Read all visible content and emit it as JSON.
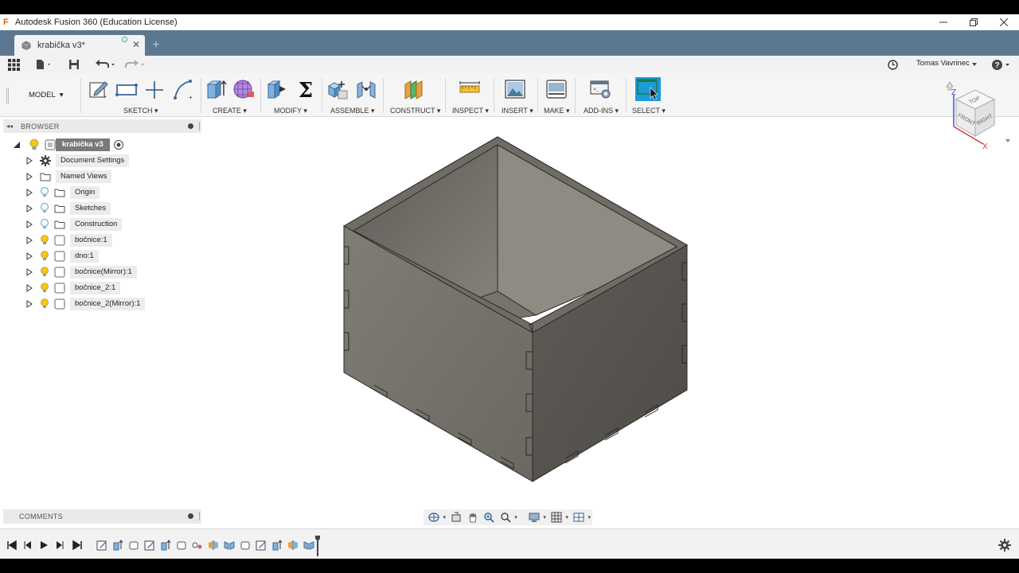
{
  "window": {
    "title": "Autodesk Fusion 360 (Education License)",
    "app_logo": "F"
  },
  "tab": {
    "label": "krabička v3*",
    "new_tab_symbol": "+"
  },
  "quickbar": {
    "user": "Tomas Vavrinec"
  },
  "toolbar": {
    "workspace": "MODEL",
    "groups": [
      {
        "label": "SKETCH"
      },
      {
        "label": "CREATE"
      },
      {
        "label": "MODIFY"
      },
      {
        "label": "ASSEMBLE"
      },
      {
        "label": "CONSTRUCT"
      },
      {
        "label": "INSPECT"
      },
      {
        "label": "INSERT"
      },
      {
        "label": "MAKE"
      },
      {
        "label": "ADD-INS"
      },
      {
        "label": "SELECT"
      }
    ]
  },
  "viewcube": {
    "faces": {
      "top": "TOP",
      "front": "FRONT",
      "right": "RIGHT"
    },
    "axes": {
      "z": "Z",
      "x": "X"
    }
  },
  "browser": {
    "title": "BROWSER",
    "root": "krabička v3",
    "items": [
      {
        "label": "Document Settings",
        "icon": "gear-icon",
        "bulb": "none"
      },
      {
        "label": "Named Views",
        "icon": "folder-icon",
        "bulb": "none"
      },
      {
        "label": "Origin",
        "icon": "folder-icon",
        "bulb": "blue"
      },
      {
        "label": "Sketches",
        "icon": "folder-icon",
        "bulb": "blue"
      },
      {
        "label": "Construction",
        "icon": "folder-icon",
        "bulb": "blue"
      },
      {
        "label": "bočnice:1",
        "icon": "body-icon",
        "bulb": "yellow"
      },
      {
        "label": "dno:1",
        "icon": "body-icon",
        "bulb": "yellow"
      },
      {
        "label": "bočnice(Mirror):1",
        "icon": "body-icon",
        "bulb": "yellow"
      },
      {
        "label": "bočnice_2:1",
        "icon": "body-icon",
        "bulb": "yellow"
      },
      {
        "label": "bočnice_2(Mirror):1",
        "icon": "body-icon",
        "bulb": "yellow"
      }
    ]
  },
  "comments": {
    "title": "COMMENTS"
  },
  "colors": {
    "tabbar": "#5b7890",
    "select_accent": "#1e9ad6",
    "model_body": "#6b6862",
    "bulb_yellow": "#f2c71a",
    "bulb_blue": "#6ab4e8"
  }
}
